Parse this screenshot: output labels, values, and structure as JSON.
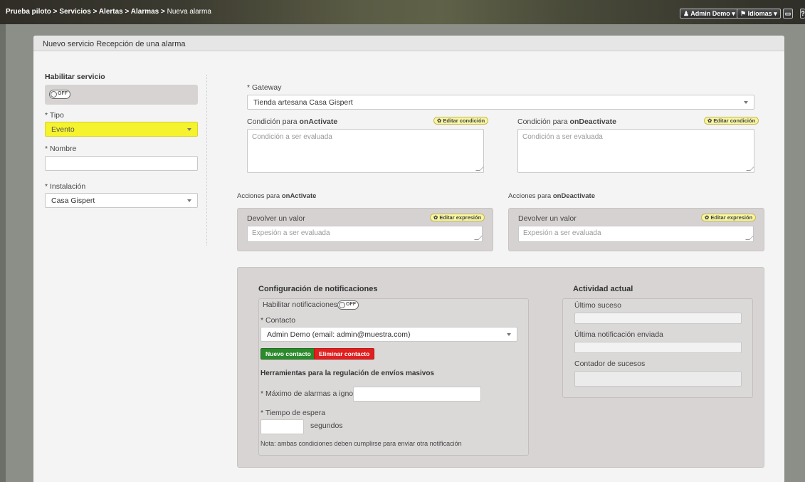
{
  "breadcrumb": [
    "Prueba piloto",
    "Servicios",
    "Alertas",
    "Alarmas",
    "Nueva alarma"
  ],
  "breadcrumb_sep": " > ",
  "topbar": {
    "user": "Admin Demo",
    "languages": "Idiomas"
  },
  "panel": {
    "title": "Nuevo servicio Recepción de una alarma"
  },
  "left": {
    "enable_label": "Habilitar servicio",
    "toggle_off": "OFF",
    "tipo_label": "* Tipo",
    "tipo_value": "Evento",
    "nombre_label": "* Nombre",
    "nombre_value": "",
    "instalacion_label": "* Instalación",
    "instalacion_value": "Casa Gispert"
  },
  "gateway": {
    "label": "* Gateway",
    "value": "Tienda artesana Casa Gispert"
  },
  "on_activate": {
    "label_prefix": "Condición para ",
    "label_bold": "onActivate",
    "edit": "Editar condición",
    "placeholder": "Condición a ser evaluada"
  },
  "on_deactivate": {
    "label_prefix": "Condición para ",
    "label_bold": "onDeactivate",
    "edit": "Editar condición",
    "placeholder": "Condición a ser evaluada"
  },
  "actions_activate": {
    "label_prefix": "Acciones para ",
    "label_bold": "onActivate",
    "title": "Devolver un valor",
    "edit": "Editar expresión",
    "placeholder": "Expesión a ser evaluada"
  },
  "actions_deactivate": {
    "label_prefix": "Acciones para ",
    "label_bold": "onDeactivate",
    "title": "Devolver un valor",
    "edit": "Editar expresión",
    "placeholder": "Expesión a ser evaluada"
  },
  "notifications": {
    "title": "Configuración de notificaciones",
    "enable_label": "Habilitar notificaciones",
    "toggle_off": "OFF",
    "contact_label": "* Contacto",
    "contact_value": "Admin Demo (email: admin@muestra.com)",
    "new_contact": "Nuevo contacto",
    "delete_contact": "Eliminar contacto",
    "tools_title": "Herramientas para la regulación de envíos masivos",
    "max_label": "* Máximo de alarmas a ignorar",
    "wait_label": "* Tiempo de espera",
    "seconds": "segundos",
    "note": "Nota: ambas condiciones deben cumplirse para enviar otra notificación"
  },
  "activity": {
    "title": "Actividad actual",
    "last_event": "Último suceso",
    "last_notification": "Última notificación enviada",
    "counter": "Contador de sucesos"
  },
  "colors": {
    "highlight": "#f5f22e",
    "green_button": "#2b8a2b",
    "red_button": "#e01f1f",
    "pill": "#f8f6a3"
  }
}
